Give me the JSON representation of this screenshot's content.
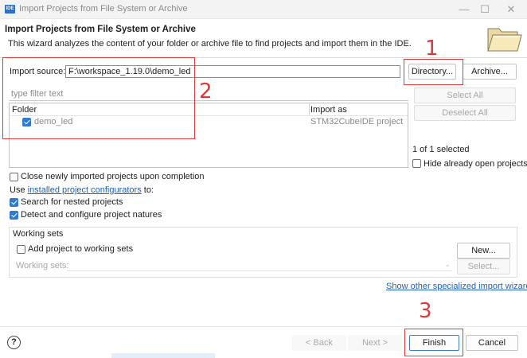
{
  "window": {
    "app_icon_text": "IDE",
    "title": "Import Projects from File System or Archive",
    "minimize_glyph": "—",
    "maximize_glyph": "☐",
    "close_glyph": "✕"
  },
  "header": {
    "title": "Import Projects from File System or Archive",
    "description": "This wizard analyzes the content of your folder or archive file to find projects and import them in the IDE.",
    "icon": "folder-icon"
  },
  "import_source": {
    "label": "Import source:",
    "value": "F:\\workspace_1.19.0\\demo_led",
    "directory_button": "Directory...",
    "archive_button": "Archive..."
  },
  "filter": {
    "placeholder": "type filter text"
  },
  "table": {
    "columns": [
      "Folder",
      "Import as"
    ],
    "rows": [
      {
        "folder": "demo_led",
        "import_as": "STM32CubeIDE project",
        "checked": true
      }
    ]
  },
  "side_buttons": {
    "select_all": "Select All",
    "deselect_all": "Deselect All"
  },
  "selection_status": "1 of 1 selected",
  "hide_open_label": "Hide already open projects",
  "options": {
    "close_imported": "Close newly imported projects upon completion",
    "use_prefix": "Use",
    "installed_link": "installed project configurators",
    "use_suffix": "to:",
    "search_nested": "Search for nested projects",
    "detect_configure": "Detect and configure project natures"
  },
  "working_sets": {
    "title": "Working sets",
    "add_label": "Add project to working sets",
    "new_button": "New...",
    "sets_label": "Working sets:",
    "select_button": "Select..."
  },
  "wizards_link": "Show other specialized import wizards",
  "footer": {
    "help_glyph": "?",
    "back": "< Back",
    "next": "Next >",
    "finish": "Finish",
    "cancel": "Cancel"
  },
  "annotations": {
    "one": "1",
    "two": "2",
    "three": "3",
    "color": "#e0383b"
  }
}
